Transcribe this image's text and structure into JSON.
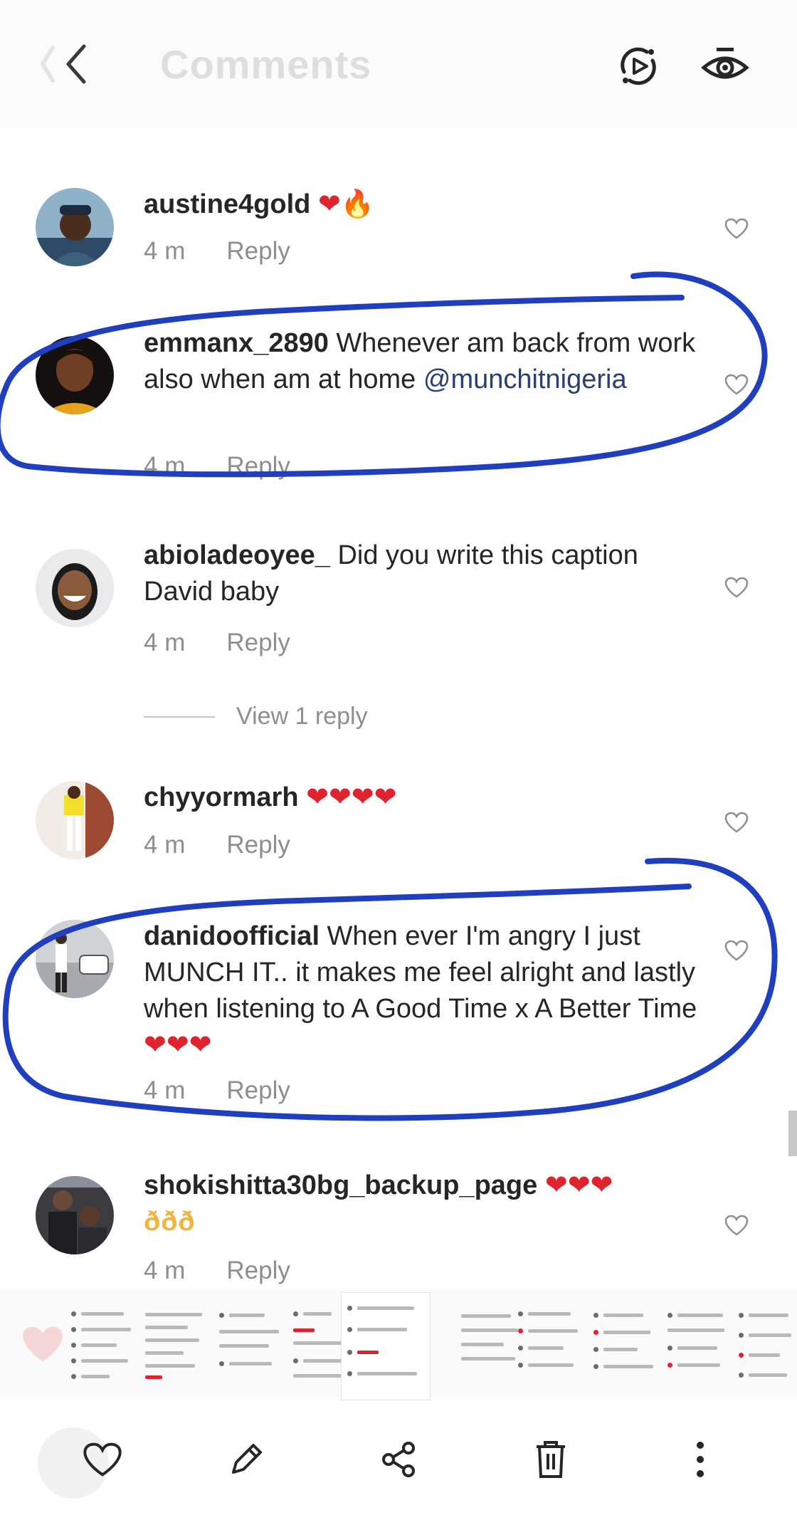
{
  "header": {
    "title": "Comments"
  },
  "comments": [
    {
      "username": "austine4gold",
      "text": "",
      "emoji": "❤🔥",
      "time": "4 m",
      "reply_label": "Reply"
    },
    {
      "username": "emmanx_2890",
      "text": " Whenever am back from work also when am at home ",
      "mention": "@munchitnigeria",
      "time": "4 m",
      "reply_label": "Reply"
    },
    {
      "username": "abioladeoyee_",
      "text": " Did you write this caption David baby",
      "time": "4 m",
      "reply_label": "Reply",
      "view_replies": "View 1 reply"
    },
    {
      "username": "chyyormarh",
      "text": "",
      "emoji": "❤❤❤❤",
      "time": "4 m",
      "reply_label": "Reply"
    },
    {
      "username": "danidoofficial",
      "text": " When ever I'm angry I just MUNCH IT.. it makes me feel alright and lastly when listening to A Good Time x A Better Time",
      "emoji": "❤❤❤",
      "time": "4 m",
      "reply_label": "Reply"
    },
    {
      "username": "shokishitta30bg_backup_page",
      "text": "",
      "emoji": "❤❤❤",
      "garbled": "ð­ð­ð­",
      "time": "4 m",
      "reply_label": "Reply"
    }
  ],
  "colors": {
    "highlight_stroke": "#1f3fbf",
    "heart": "#e0242f",
    "muted_text": "#8e8e8e"
  },
  "toolbar": {
    "icons": [
      "heart-icon",
      "edit-icon",
      "share-icon",
      "trash-icon",
      "more-icon"
    ]
  }
}
